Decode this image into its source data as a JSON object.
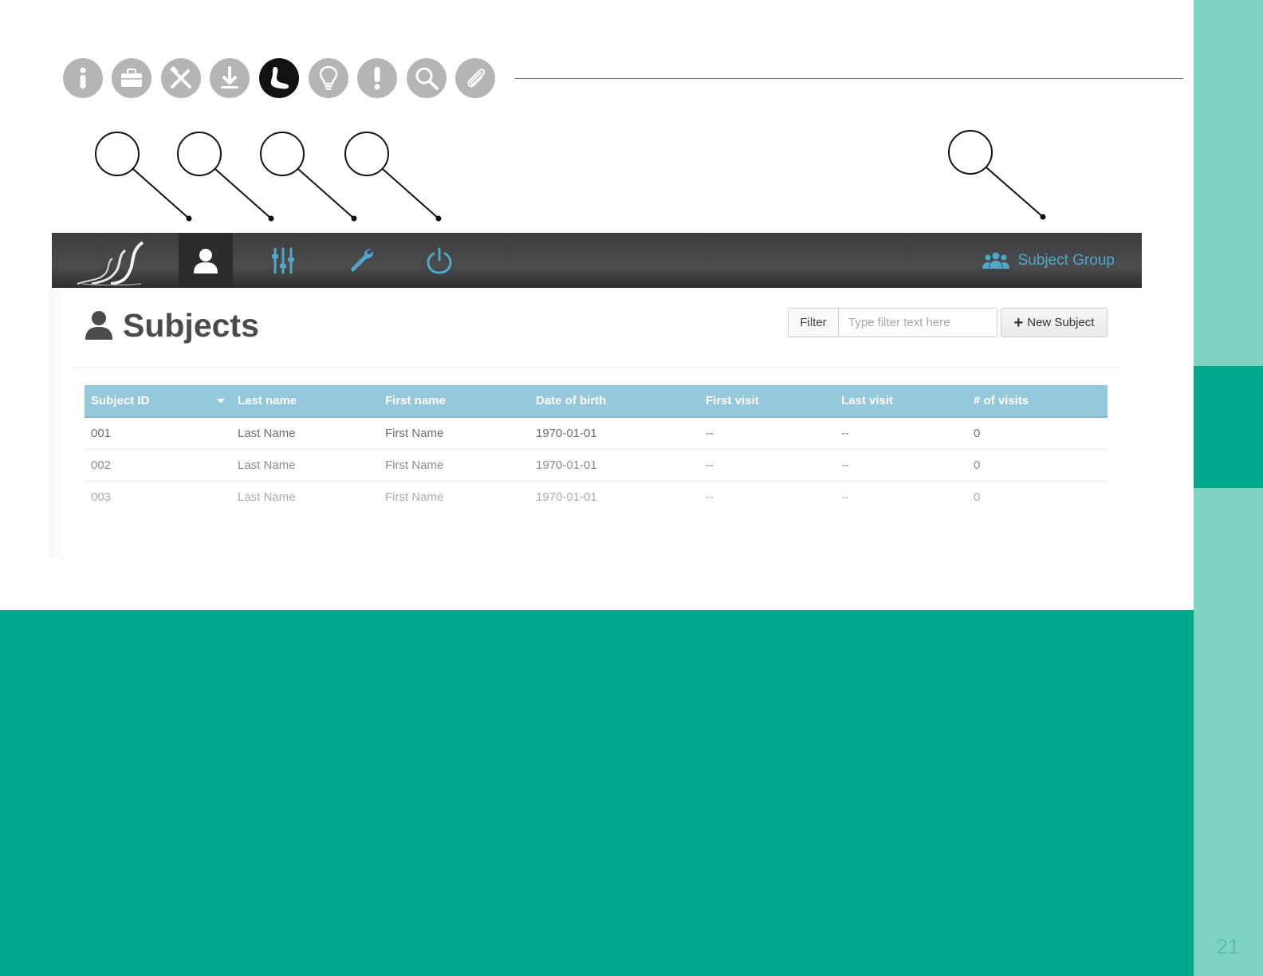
{
  "colors": {
    "side_light": "#7fd3c3",
    "side_dark": "#00a98a",
    "bottom_block": "#00a98a",
    "navbar_accent": "#4fa8c8",
    "table_header": "#95c8dc"
  },
  "legend_icons": [
    {
      "name": "info-icon"
    },
    {
      "name": "briefcase-icon"
    },
    {
      "name": "tools-icon"
    },
    {
      "name": "download-icon"
    },
    {
      "name": "foot-icon",
      "active": true
    },
    {
      "name": "lightbulb-icon"
    },
    {
      "name": "exclamation-icon"
    },
    {
      "name": "search-icon"
    },
    {
      "name": "paperclip-icon"
    }
  ],
  "navbar": {
    "items": [
      {
        "name": "user-icon",
        "active": true
      },
      {
        "name": "sliders-icon"
      },
      {
        "name": "wrench-icon"
      },
      {
        "name": "power-icon"
      }
    ],
    "group_label": "Subject Group",
    "group_icon": "users-icon"
  },
  "page": {
    "title": "Subjects",
    "filter_label": "Filter",
    "filter_placeholder": "Type filter text here",
    "new_button_label": "New Subject"
  },
  "table": {
    "columns": [
      "Subject ID",
      "Last name",
      "First name",
      "Date of birth",
      "First visit",
      "Last visit",
      "# of visits"
    ],
    "sorted_column": 0,
    "rows": [
      [
        "001",
        "Last Name",
        "First Name",
        "1970-01-01",
        "--",
        "--",
        "0"
      ],
      [
        "002",
        "Last Name",
        "First Name",
        "1970-01-01",
        "--",
        "--",
        "0"
      ],
      [
        "003",
        "Last Name",
        "First Name",
        "1970-01-01",
        "--",
        "--",
        "0"
      ]
    ]
  },
  "page_number": "21"
}
